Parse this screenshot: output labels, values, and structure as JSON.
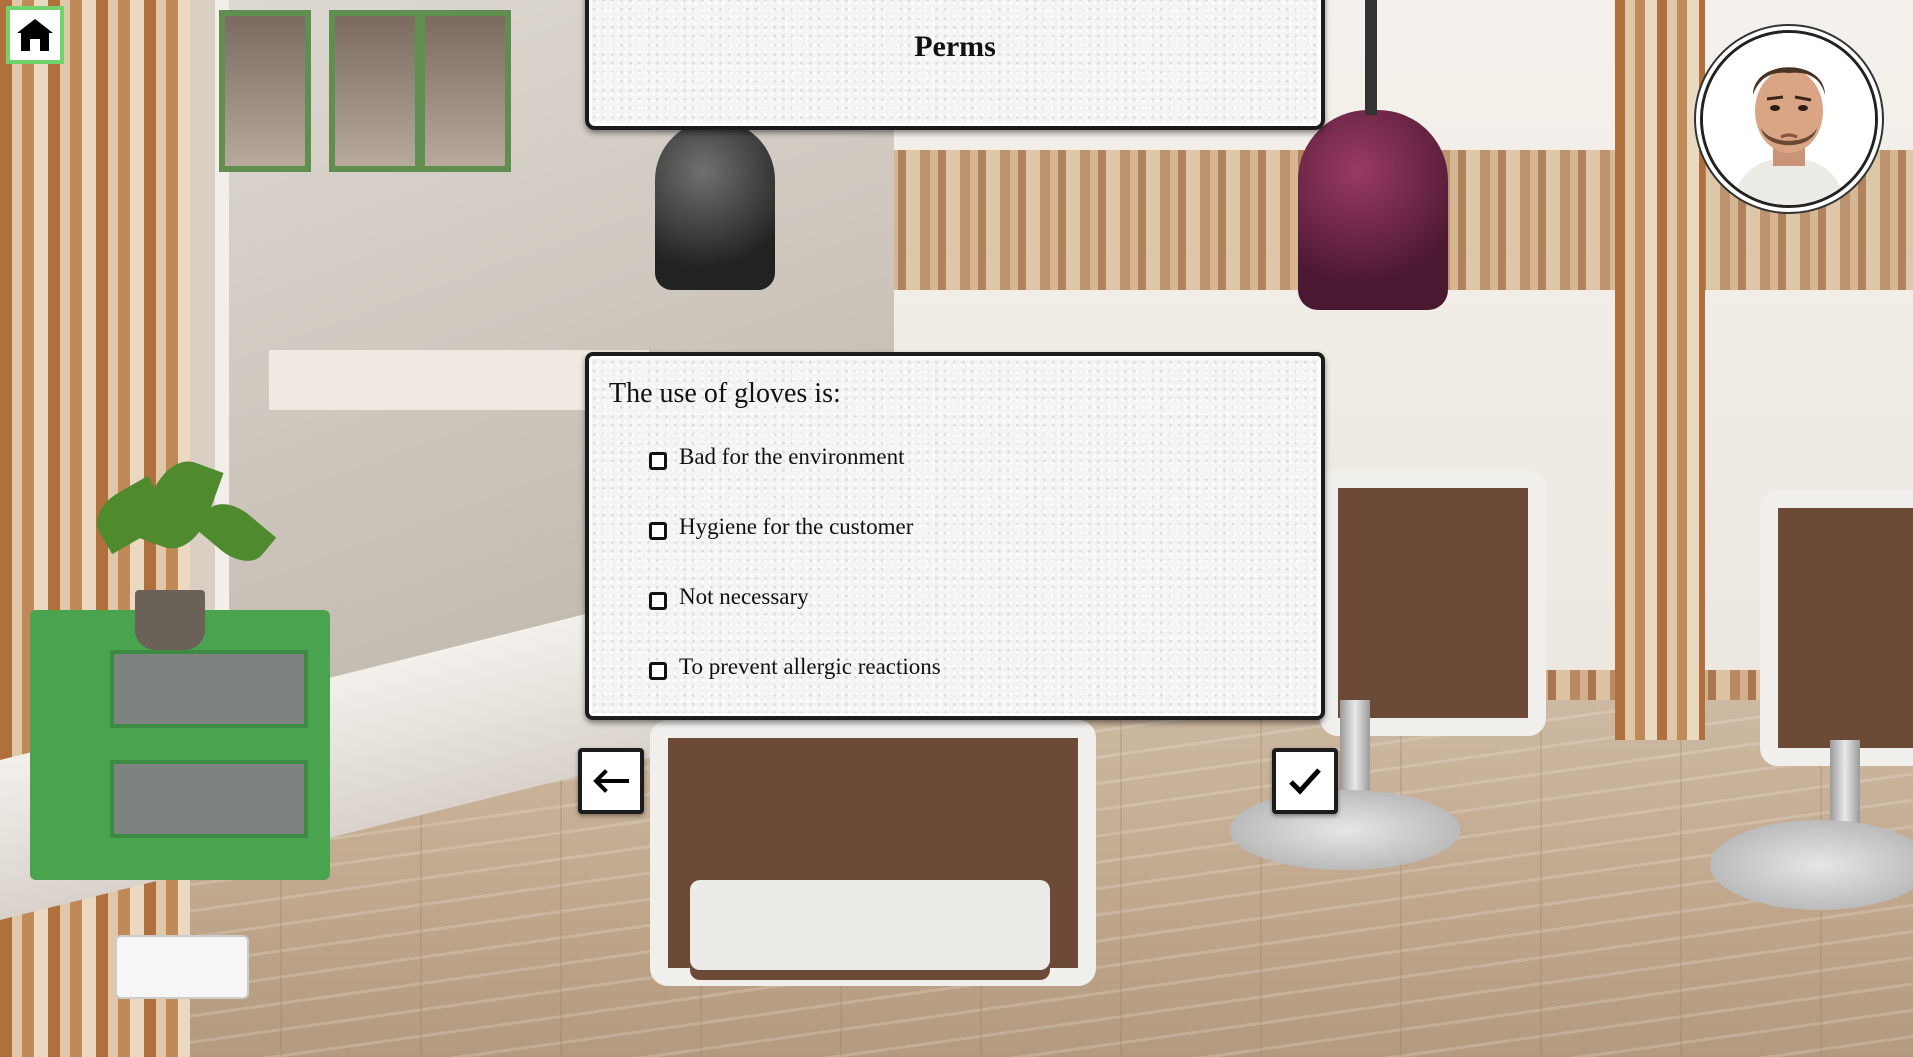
{
  "header": {
    "title": "Perms"
  },
  "home_button": {
    "icon": "house-icon"
  },
  "avatar": {
    "icon": "customer-avatar"
  },
  "quiz": {
    "question": "The use of gloves is:",
    "options": [
      {
        "label": "Bad for the environment",
        "checked": false
      },
      {
        "label": "Hygiene for the customer",
        "checked": false
      },
      {
        "label": "Not necessary",
        "checked": false
      },
      {
        "label": "To prevent allergic reactions",
        "checked": false
      }
    ]
  },
  "navigation": {
    "back_icon": "arrow-left-icon",
    "confirm_icon": "checkmark-icon"
  },
  "colors": {
    "home_border": "#6fd36a",
    "panel_border": "#1c1c1c",
    "panel_bg": "#f4f4f4"
  }
}
